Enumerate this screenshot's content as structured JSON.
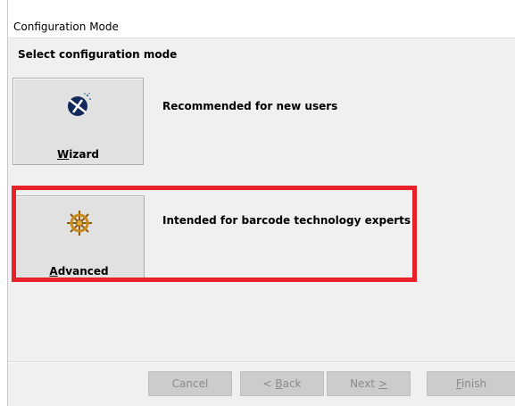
{
  "window": {
    "title": "Configuration Mode"
  },
  "heading": "Select configuration mode",
  "modes": [
    {
      "label": "Wizard",
      "description": "Recommended for new users",
      "icon": "wizard-wand-icon"
    },
    {
      "label": "Advanced",
      "description": "Intended for barcode technology experts",
      "icon": "ship-wheel-icon"
    }
  ],
  "footer": {
    "cancel": "Cancel",
    "back": "< Back",
    "next": "Next >",
    "finish": "Finish"
  },
  "colors": {
    "highlight": "#e8202a",
    "button_face": "#e1e1e1",
    "window_bg": "#f0f0f0"
  }
}
